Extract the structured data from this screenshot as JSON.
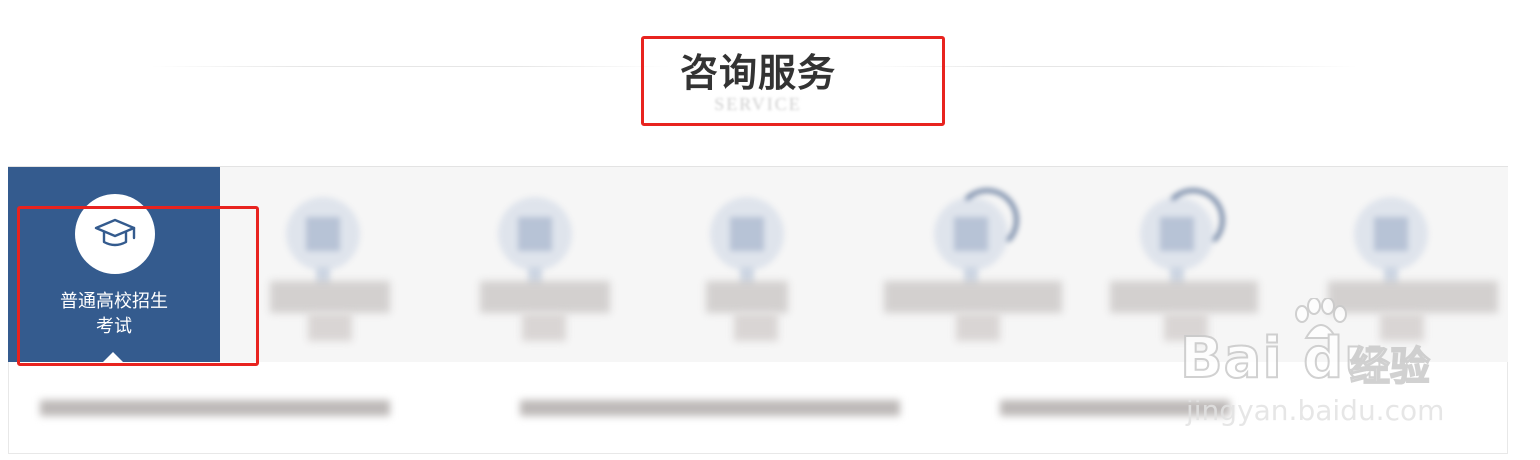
{
  "section": {
    "title": "咨询服务",
    "subtitle": "SERVICE"
  },
  "tabs": [
    {
      "label_line1": "普通高校招生",
      "label_line2": "考试",
      "icon": "graduation-cap-icon",
      "active": true
    },
    {
      "label_line1": "",
      "label_line2": "",
      "icon": "blurred-icon",
      "active": false
    },
    {
      "label_line1": "",
      "label_line2": "",
      "icon": "blurred-icon",
      "active": false
    },
    {
      "label_line1": "",
      "label_line2": "",
      "icon": "blurred-icon",
      "active": false
    },
    {
      "label_line1": "",
      "label_line2": "",
      "icon": "blurred-icon",
      "active": false
    },
    {
      "label_line1": "",
      "label_line2": "",
      "icon": "blurred-icon",
      "active": false
    },
    {
      "label_line1": "",
      "label_line2": "",
      "icon": "blurred-icon",
      "active": false
    }
  ],
  "watermark": {
    "brand": "Bai du",
    "cn": "经验",
    "site": "jingyan.baidu.com"
  },
  "colors": {
    "active_tab": "#345b8e",
    "annotation": "#e8231f",
    "title": "#333333"
  }
}
